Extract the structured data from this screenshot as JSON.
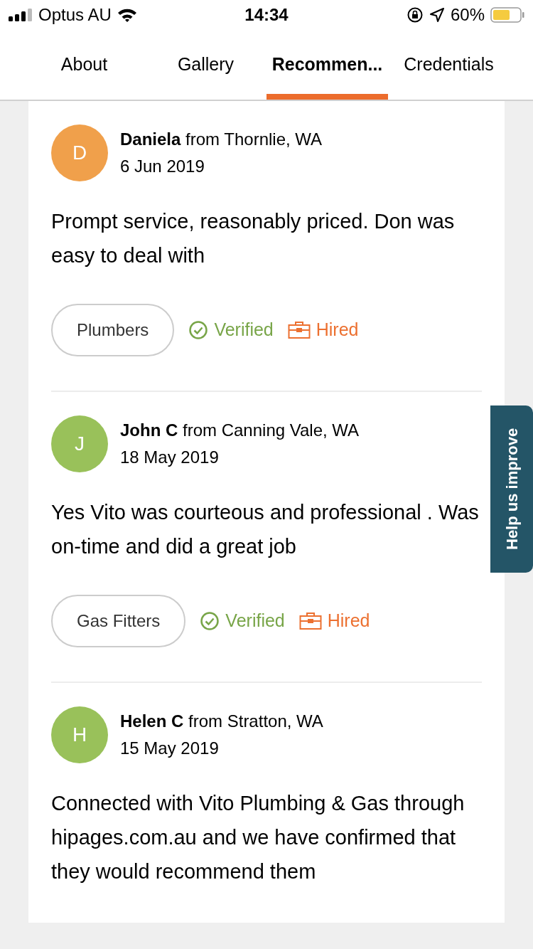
{
  "status_bar": {
    "carrier": "Optus AU",
    "time": "14:34",
    "battery": "60%"
  },
  "tabs": [
    {
      "label": "About",
      "selected": false
    },
    {
      "label": "Gallery",
      "selected": false
    },
    {
      "label": "Recommen...",
      "selected": true
    },
    {
      "label": "Credentials",
      "selected": false
    }
  ],
  "reviews": [
    {
      "initial": "D",
      "color": "#f0a04b",
      "name": "Daniela",
      "location": "from Thornlie, WA",
      "date": "6 Jun 2019",
      "text": "Prompt service, reasonably priced. Don was easy to deal with",
      "tag": "Plumbers",
      "badges": [
        {
          "kind": "verified",
          "label": "Verified"
        },
        {
          "kind": "hired",
          "label": "Hired"
        }
      ]
    },
    {
      "initial": "J",
      "color": "#99c15a",
      "name": "John C",
      "location": "from Canning Vale, WA",
      "date": "18 May 2019",
      "text": "Yes Vito was courteous and professional . Was on-time and did a great job",
      "tag": "Gas Fitters",
      "badges": [
        {
          "kind": "verified",
          "label": "Verified"
        },
        {
          "kind": "hired",
          "label": "Hired"
        }
      ]
    },
    {
      "initial": "H",
      "color": "#99c15a",
      "name": "Helen C",
      "location": "from Stratton, WA",
      "date": "15 May 2019",
      "text": "Connected with Vito Plumbing & Gas through hipages.com.au and we have confirmed that they would recommend them"
    }
  ],
  "feedback_tab": {
    "label": "Help us improve"
  }
}
